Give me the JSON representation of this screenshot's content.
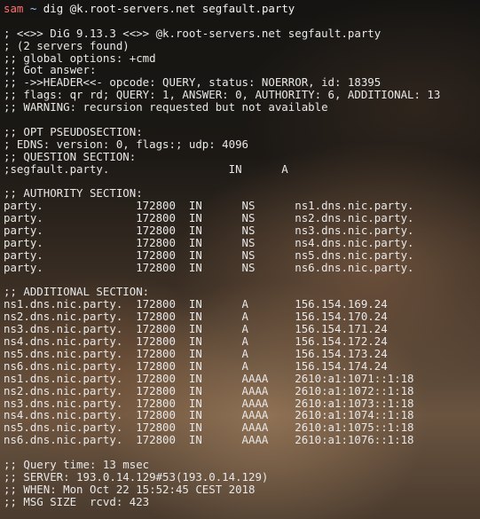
{
  "prompt": {
    "user": "sam",
    "cwd": "~",
    "command": "dig @k.root-servers.net segfault.party"
  },
  "header_lines": [
    "; <<>> DiG 9.13.3 <<>> @k.root-servers.net segfault.party",
    "; (2 servers found)",
    ";; global options: +cmd",
    ";; Got answer:",
    ";; ->>HEADER<<- opcode: QUERY, status: NOERROR, id: 18395",
    ";; flags: qr rd; QUERY: 1, ANSWER: 0, AUTHORITY: 6, ADDITIONAL: 13",
    ";; WARNING: recursion requested but not available"
  ],
  "opt_lines": [
    ";; OPT PSEUDOSECTION:",
    "; EDNS: version: 0, flags:; udp: 4096",
    ";; QUESTION SECTION:",
    ";segfault.party.                  IN      A"
  ],
  "authority_header": ";; AUTHORITY SECTION:",
  "authority_records": [
    "party.              172800  IN      NS      ns1.dns.nic.party.",
    "party.              172800  IN      NS      ns2.dns.nic.party.",
    "party.              172800  IN      NS      ns3.dns.nic.party.",
    "party.              172800  IN      NS      ns4.dns.nic.party.",
    "party.              172800  IN      NS      ns5.dns.nic.party.",
    "party.              172800  IN      NS      ns6.dns.nic.party."
  ],
  "additional_header": ";; ADDITIONAL SECTION:",
  "additional_records": [
    "ns1.dns.nic.party.  172800  IN      A       156.154.169.24",
    "ns2.dns.nic.party.  172800  IN      A       156.154.170.24",
    "ns3.dns.nic.party.  172800  IN      A       156.154.171.24",
    "ns4.dns.nic.party.  172800  IN      A       156.154.172.24",
    "ns5.dns.nic.party.  172800  IN      A       156.154.173.24",
    "ns6.dns.nic.party.  172800  IN      A       156.154.174.24",
    "ns1.dns.nic.party.  172800  IN      AAAA    2610:a1:1071::1:18",
    "ns2.dns.nic.party.  172800  IN      AAAA    2610:a1:1072::1:18",
    "ns3.dns.nic.party.  172800  IN      AAAA    2610:a1:1073::1:18",
    "ns4.dns.nic.party.  172800  IN      AAAA    2610:a1:1074::1:18",
    "ns5.dns.nic.party.  172800  IN      AAAA    2610:a1:1075::1:18",
    "ns6.dns.nic.party.  172800  IN      AAAA    2610:a1:1076::1:18"
  ],
  "footer_lines": [
    ";; Query time: 13 msec",
    ";; SERVER: 193.0.14.129#53(193.0.14.129)",
    ";; WHEN: Mon Oct 22 15:52:45 CEST 2018",
    ";; MSG SIZE  rcvd: 423"
  ],
  "colors": {
    "prompt_user": "#ff6f6f",
    "prompt_cwd": "#9ecbff",
    "text": "#e8e8e8"
  }
}
